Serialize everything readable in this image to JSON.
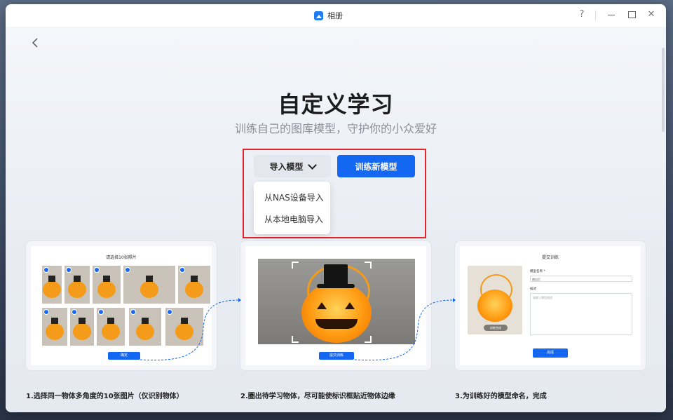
{
  "window": {
    "title": "相册",
    "controls": {
      "help": "?",
      "close": "✕"
    }
  },
  "header": {
    "title": "自定义学习",
    "subtitle": "训练自己的图库模型，守护你的小众爱好"
  },
  "actions": {
    "import_label": "导入模型",
    "train_label": "训练新模型",
    "import_menu": [
      "从NAS设备导入",
      "从本地电脑导入"
    ]
  },
  "steps": [
    {
      "title": "请选择10张照片",
      "button": "确定",
      "caption": "1.选择同一物体多角度的10张图片（仅识别物体）"
    },
    {
      "button": "提交训练",
      "caption": "2.圈出待学习物体，尽可能使标识框贴近物体边缘"
    },
    {
      "title": "提交训练",
      "name_label": "模型名称 *",
      "name_value": "南瓜灯",
      "desc_label": "描述",
      "desc_placeholder": "请输入模型描述",
      "badge": "训练完成",
      "button": "完成",
      "caption": "3.为训练好的模型命名，完成"
    }
  ],
  "colors": {
    "primary": "#1467f0",
    "highlight": "#e3262c",
    "pumpkin": "#f59b1a"
  }
}
